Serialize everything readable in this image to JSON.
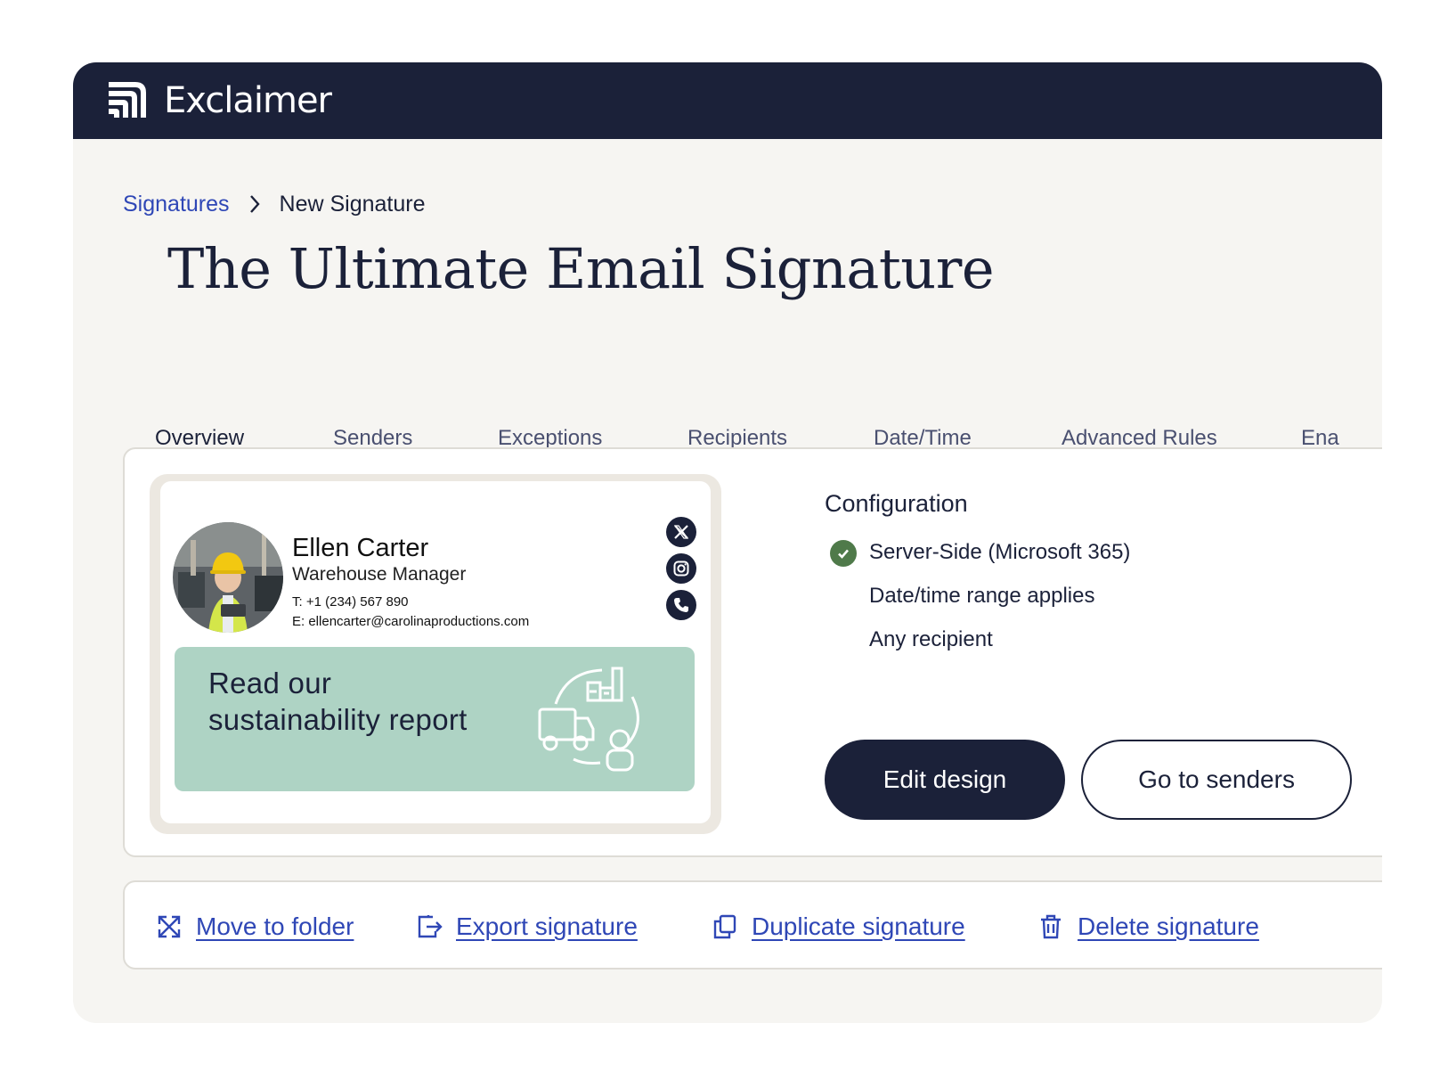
{
  "app": {
    "brand": "Exclaimer"
  },
  "breadcrumb": {
    "parent": "Signatures",
    "current": "New Signature"
  },
  "page": {
    "title": "The Ultimate Email Signature"
  },
  "tabs": [
    {
      "label": "Overview",
      "active": true
    },
    {
      "label": "Senders",
      "active": false
    },
    {
      "label": "Exceptions",
      "active": false
    },
    {
      "label": "Recipients",
      "active": false
    },
    {
      "label": "Date/Time",
      "active": false
    },
    {
      "label": "Advanced Rules",
      "active": false
    },
    {
      "label": "Ena",
      "active": false
    }
  ],
  "signature": {
    "name": "Ellen Carter",
    "role": "Warehouse Manager",
    "phone": "T: +1 (234) 567 890",
    "email": "E: ellencarter@carolinaproductions.com",
    "social_icons": [
      "x-icon",
      "instagram-icon",
      "phone-icon"
    ],
    "banner_text": "Read our sustainability report"
  },
  "configuration": {
    "title": "Configuration",
    "items": [
      "Server-Side (Microsoft 365)",
      "Date/time range applies",
      "Any recipient"
    ]
  },
  "buttons": {
    "edit_design": "Edit design",
    "go_to_senders": "Go to senders"
  },
  "actions": [
    {
      "label": "Move to folder",
      "icon": "move-icon"
    },
    {
      "label": "Export signature",
      "icon": "export-icon"
    },
    {
      "label": "Duplicate signature",
      "icon": "duplicate-icon"
    },
    {
      "label": "Delete signature",
      "icon": "trash-icon"
    }
  ],
  "colors": {
    "navy": "#1b2139",
    "link": "#2f47b6",
    "banner": "#aed3c4",
    "accent_tab": "#4a72e0",
    "check": "#4f7a4a"
  }
}
